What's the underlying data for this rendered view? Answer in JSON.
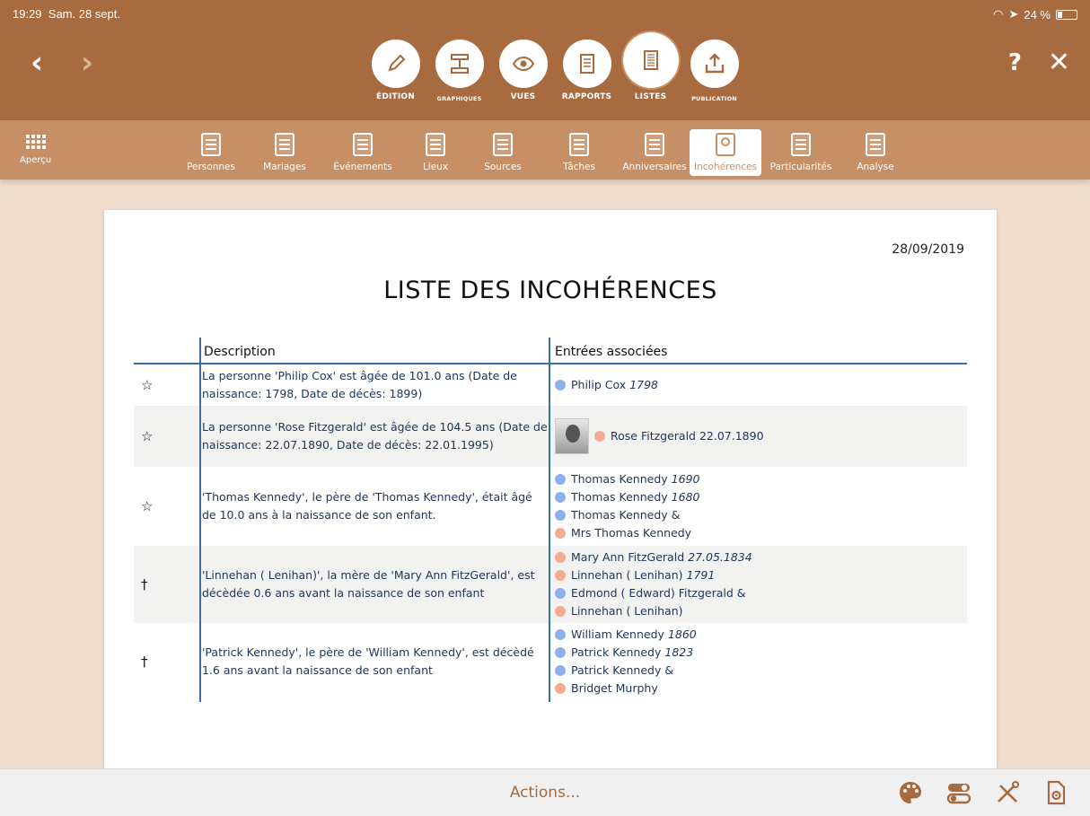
{
  "status": {
    "time": "19:29",
    "date": "Sam. 28 sept.",
    "battery": "24 %"
  },
  "modes": [
    {
      "label": "ÉDITION",
      "icon": "pencil-icon",
      "small": false,
      "active": false
    },
    {
      "label": "GRAPHIQUES",
      "icon": "tree-chart-icon",
      "small": true,
      "active": false
    },
    {
      "label": "VUES",
      "icon": "eye-icon",
      "small": false,
      "active": false
    },
    {
      "label": "RAPPORTS",
      "icon": "report-icon",
      "small": false,
      "active": false
    },
    {
      "label": "LISTES",
      "icon": "list-icon",
      "small": false,
      "active": true
    },
    {
      "label": "PUBLICATION",
      "icon": "upload-icon",
      "small": true,
      "active": false
    }
  ],
  "topbar": {
    "help": "?",
    "close": "✕"
  },
  "apercu": {
    "label": "Aperçu"
  },
  "list_tabs": [
    {
      "label": "Personnes",
      "active": false
    },
    {
      "label": "Mariages",
      "active": false
    },
    {
      "label": "Événements",
      "active": false
    },
    {
      "label": "Lieux",
      "active": false
    },
    {
      "label": "Sources",
      "active": false
    },
    {
      "label": "Tâches",
      "active": false
    },
    {
      "label": "Anniversaires",
      "active": false
    },
    {
      "label": "Incohérences",
      "active": true
    },
    {
      "label": "Particularités",
      "active": false
    },
    {
      "label": "Analyse",
      "active": false
    }
  ],
  "document": {
    "date": "28/09/2019",
    "title": "LISTE DES INCOHÉRENCES",
    "headers": {
      "description": "Description",
      "entries": "Entrées associées"
    },
    "rows": [
      {
        "symbol": "☆",
        "description": "La personne 'Philip Cox' est âgée de 101.0 ans (Date de naissance: 1798, Date de décès: 1899)",
        "photo": false,
        "entries": [
          {
            "name": "Philip Cox",
            "date": "1798",
            "sex": "m"
          }
        ]
      },
      {
        "symbol": "☆",
        "description": "La personne 'Rose Fitzgerald' est âgée de 104.5 ans (Date de naissance: 22.07.1890, Date de décès: 22.01.1995)",
        "photo": true,
        "entries": [
          {
            "name": "Rose Fitzgerald 22.07.1890",
            "date": "",
            "sex": "f"
          }
        ]
      },
      {
        "symbol": "☆",
        "description": "'Thomas Kennedy', le père de 'Thomas Kennedy', était âgé de 10.0 ans à la naissance de son enfant.",
        "photo": false,
        "entries": [
          {
            "name": "Thomas Kennedy",
            "date": "1690",
            "sex": "m"
          },
          {
            "name": "Thomas Kennedy",
            "date": "1680",
            "sex": "m"
          },
          {
            "name": "Thomas Kennedy &",
            "date": "",
            "sex": "m"
          },
          {
            "name": "Mrs Thomas Kennedy",
            "date": "",
            "sex": "f"
          }
        ]
      },
      {
        "symbol": "†",
        "description": "'Linnehan ( Lenihan)', la mère de 'Mary Ann FitzGerald', est décèdée 0.6 ans avant la naissance de son enfant",
        "photo": false,
        "entries": [
          {
            "name": "Mary Ann FitzGerald",
            "date": "27.05.1834",
            "sex": "f"
          },
          {
            "name": "Linnehan ( Lenihan)",
            "date": "1791",
            "sex": "f"
          },
          {
            "name": "Edmond ( Edward) Fitzgerald &",
            "date": "",
            "sex": "m"
          },
          {
            "name": "Linnehan ( Lenihan)",
            "date": "",
            "sex": "f"
          }
        ]
      },
      {
        "symbol": "†",
        "description": "'Patrick Kennedy', le père de 'William Kennedy', est décèdé 1.6 ans avant la naissance de son enfant",
        "photo": false,
        "entries": [
          {
            "name": "William Kennedy",
            "date": "1860",
            "sex": "m"
          },
          {
            "name": "Patrick Kennedy",
            "date": "1823",
            "sex": "m"
          },
          {
            "name": "Patrick Kennedy &",
            "date": "",
            "sex": "m"
          },
          {
            "name": "Bridget Murphy",
            "date": "",
            "sex": "f"
          }
        ]
      }
    ]
  },
  "bottombar": {
    "actions_label": "Actions...",
    "icons": [
      "palette-icon",
      "toggle-settings-icon",
      "tools-icon",
      "document-settings-icon"
    ]
  }
}
